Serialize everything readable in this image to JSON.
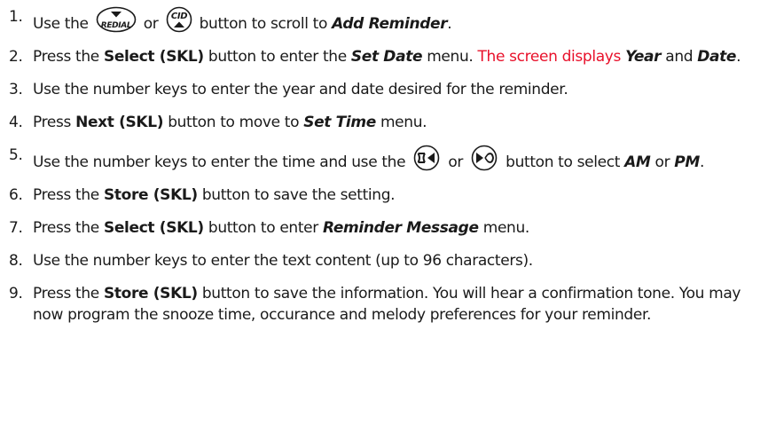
{
  "icons": {
    "redial": "REDIAL",
    "cid": "CID"
  },
  "steps": [
    {
      "num": "1.",
      "a": "Use the",
      "b": "or",
      "c": "button to scroll to",
      "d": "Add Reminder",
      "e": "."
    },
    {
      "num": "2.",
      "a": "Press the",
      "b": "Select (SKL)",
      "c": "button to enter the",
      "d": "Set Date",
      "e": "menu.",
      "f": "The screen displays",
      "g": "Year",
      "h": "and",
      "i": "Date",
      "j": "."
    },
    {
      "num": "3.",
      "a": "Use the number keys to enter the year and date desired for the reminder."
    },
    {
      "num": "4.",
      "a": "Press",
      "b": "Next (SKL)",
      "c": "button to move to",
      "d": "Set Time",
      "e": "menu."
    },
    {
      "num": "5.",
      "a": "Use the number keys to enter the time and use the",
      "b": "or",
      "c": "button to select",
      "d": "AM",
      "e": "or",
      "f": "PM",
      "g": "."
    },
    {
      "num": "6.",
      "a": "Press the",
      "b": "Store (SKL)",
      "c": "button to save the setting."
    },
    {
      "num": "7.",
      "a": "Press the",
      "b": "Select (SKL)",
      "c": "button to enter",
      "d": "Reminder Message",
      "e": "menu."
    },
    {
      "num": "8.",
      "a": "Use the number keys to enter the text content (up to 96 characters)."
    },
    {
      "num": "9.",
      "a": "Press the",
      "b": "Store (SKL)",
      "c": "button to save the information. You will hear a confirmation tone. You may now program the snooze time, occurance and melody preferences for your reminder."
    }
  ]
}
